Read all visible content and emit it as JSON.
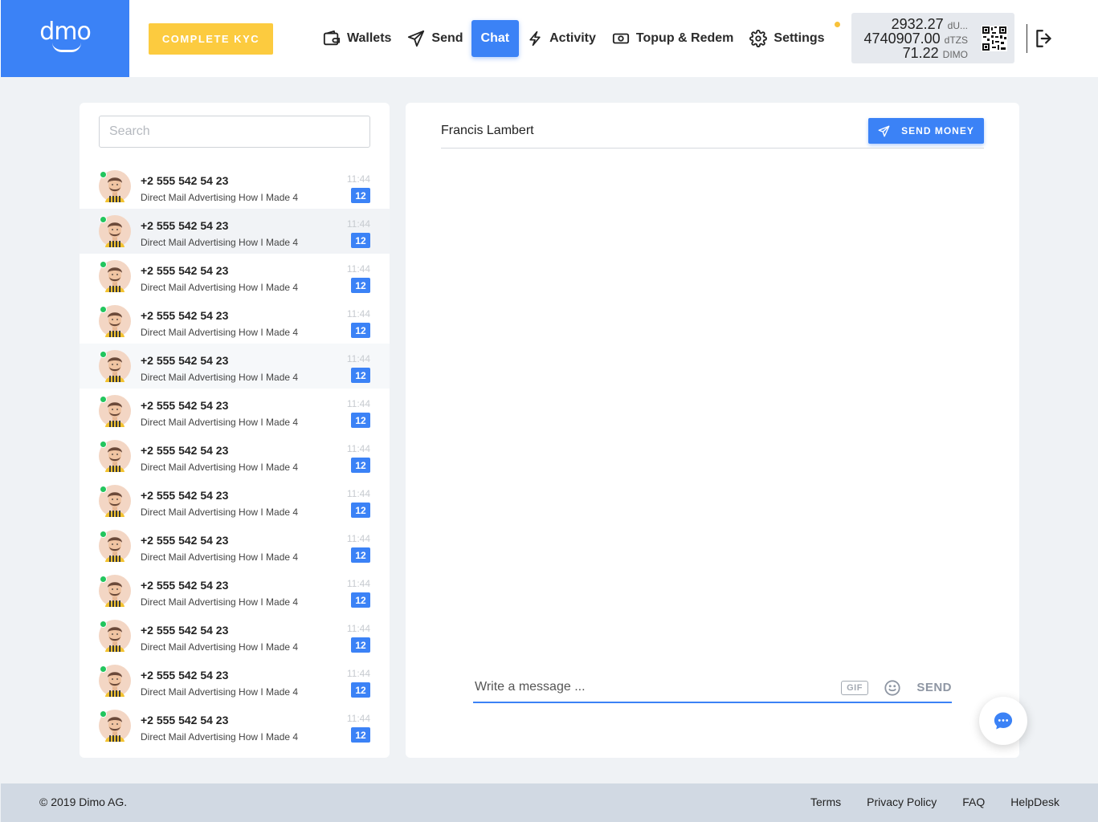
{
  "brand": {
    "logo_text": "dmo"
  },
  "header": {
    "kyc_label": "COMPLETE KYC",
    "nav": [
      {
        "label": "Wallets",
        "icon": "wallet-icon"
      },
      {
        "label": "Send",
        "icon": "send-icon"
      },
      {
        "label": "Chat",
        "icon": "",
        "active": true
      },
      {
        "label": "Activity",
        "icon": "lightning-icon"
      },
      {
        "label": "Topup & Redem",
        "icon": "cash-icon"
      },
      {
        "label": "Settings",
        "icon": "gear-icon"
      }
    ],
    "balances": [
      {
        "value": "2932.27",
        "unit": "dU..."
      },
      {
        "value": "4740907.00",
        "unit": "dTZS"
      },
      {
        "value": "71.22",
        "unit": "DIMO"
      }
    ]
  },
  "contacts": {
    "search_placeholder": "Search",
    "items": [
      {
        "phone": "+2 555 542 54 23",
        "preview": "Direct Mail Advertising How I Made 4",
        "time": "11:44",
        "unread": "12"
      },
      {
        "phone": "+2 555 542 54 23",
        "preview": "Direct Mail Advertising How I Made 4",
        "time": "11:44",
        "unread": "12"
      },
      {
        "phone": "+2 555 542 54 23",
        "preview": "Direct Mail Advertising How I Made 4",
        "time": "11:44",
        "unread": "12"
      },
      {
        "phone": "+2 555 542 54 23",
        "preview": "Direct Mail Advertising How I Made 4",
        "time": "11:44",
        "unread": "12"
      },
      {
        "phone": "+2 555 542 54 23",
        "preview": "Direct Mail Advertising How I Made 4",
        "time": "11:44",
        "unread": "12"
      },
      {
        "phone": "+2 555 542 54 23",
        "preview": "Direct Mail Advertising How I Made 4",
        "time": "11:44",
        "unread": "12"
      },
      {
        "phone": "+2 555 542 54 23",
        "preview": "Direct Mail Advertising How I Made 4",
        "time": "11:44",
        "unread": "12"
      },
      {
        "phone": "+2 555 542 54 23",
        "preview": "Direct Mail Advertising How I Made 4",
        "time": "11:44",
        "unread": "12"
      },
      {
        "phone": "+2 555 542 54 23",
        "preview": "Direct Mail Advertising How I Made 4",
        "time": "11:44",
        "unread": "12"
      },
      {
        "phone": "+2 555 542 54 23",
        "preview": "Direct Mail Advertising How I Made 4",
        "time": "11:44",
        "unread": "12"
      },
      {
        "phone": "+2 555 542 54 23",
        "preview": "Direct Mail Advertising How I Made 4",
        "time": "11:44",
        "unread": "12"
      },
      {
        "phone": "+2 555 542 54 23",
        "preview": "Direct Mail Advertising How I Made 4",
        "time": "11:44",
        "unread": "12"
      },
      {
        "phone": "+2 555 542 54 23",
        "preview": "Direct Mail Advertising How I Made 4",
        "time": "11:44",
        "unread": "12"
      }
    ]
  },
  "chat": {
    "contact_name": "Francis Lambert",
    "send_money_label": "SEND MONEY",
    "compose_placeholder": "Write a message ...",
    "gif_label": "GIF",
    "send_label": "SEND"
  },
  "footer": {
    "copyright": "© 2019 Dimo AG.",
    "links": [
      "Terms",
      "Privacy Policy",
      "FAQ",
      "HelpDesk"
    ]
  },
  "colors": {
    "brand_blue": "#3b82f6",
    "kyc_yellow": "#fccb3f",
    "online_green": "#22c55e",
    "footer_bg": "#d1d9e3"
  }
}
